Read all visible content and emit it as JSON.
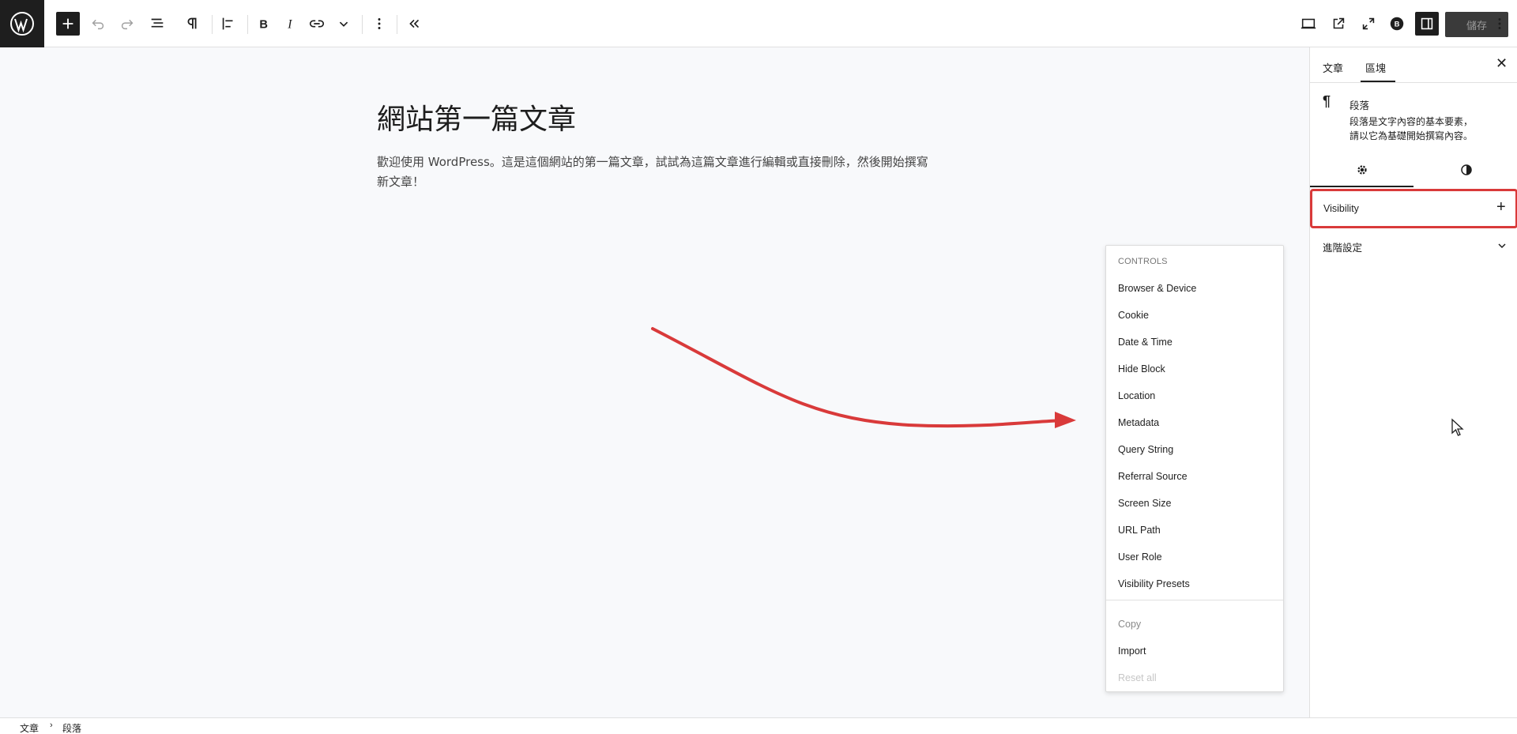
{
  "toolbar": {
    "save_label": "儲存"
  },
  "post": {
    "title": "網站第一篇文章",
    "body": "歡迎使用 WordPress。這是這個網站的第一篇文章，試試為這篇文章進行編輯或直接刪除，然後開始撰寫新文章！"
  },
  "dropdown": {
    "heading": "CONTROLS",
    "items": [
      "Browser & Device",
      "Cookie",
      "Date & Time",
      "Hide Block",
      "Location",
      "Metadata",
      "Query String",
      "Referral Source",
      "Screen Size",
      "URL Path",
      "User Role",
      "Visibility Presets"
    ],
    "copy": "Copy",
    "import": "Import",
    "reset": "Reset all"
  },
  "sidebar": {
    "tab_post": "文章",
    "tab_block": "區塊",
    "block_title": "段落",
    "block_desc_1": "段落是文字內容的基本要素，",
    "block_desc_2": "請以它為基礎開始撰寫內容。",
    "visibility_label": "Visibility",
    "advanced_label": "進階設定"
  },
  "footer": {
    "crumb_1": "文章",
    "crumb_2": "段落"
  },
  "colors": {
    "highlight": "#d93a3a",
    "dark": "#1e1e1e"
  }
}
